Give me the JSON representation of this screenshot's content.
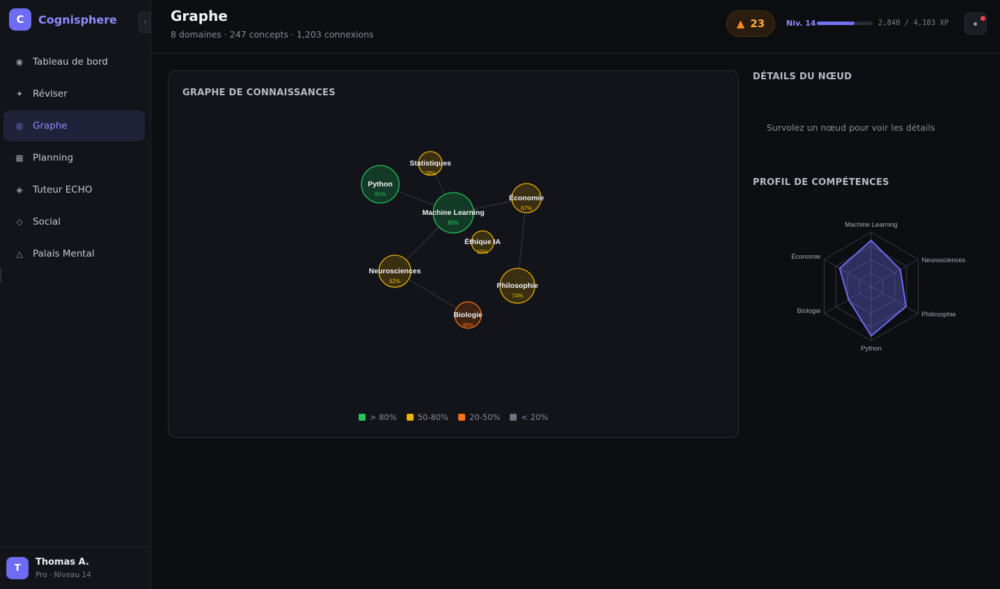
{
  "brand": {
    "logo_letter": "C",
    "name": "Cognisphere",
    "collapse_icon": "‹"
  },
  "nav": [
    {
      "key": "dashboard",
      "label": "Tableau de bord",
      "icon": "◉",
      "active": false
    },
    {
      "key": "review",
      "label": "Réviser",
      "icon": "✦",
      "active": false
    },
    {
      "key": "graph",
      "label": "Graphe",
      "icon": "◎",
      "active": true
    },
    {
      "key": "planning",
      "label": "Planning",
      "icon": "▦",
      "active": false
    },
    {
      "key": "tutor",
      "label": "Tuteur ECHO",
      "icon": "◈",
      "active": false
    },
    {
      "key": "social",
      "label": "Social",
      "icon": "◇",
      "active": false
    },
    {
      "key": "palace",
      "label": "Palais Mental",
      "icon": "△",
      "active": false
    }
  ],
  "user": {
    "initial": "T",
    "name": "Thomas A.",
    "subtitle": "Pro · Niveau 14"
  },
  "header": {
    "title": "Graphe",
    "subtitle": "8 domaines · 247 concepts · 1,203 connexions",
    "streak": "23",
    "level": "Niv. 14",
    "xp_text": "2,840 / 4,183 XP",
    "xp_fraction": 0.679
  },
  "colors": {
    "green": "#22c55e",
    "yellow": "#eab308",
    "orange": "#f97316",
    "gray": "#6b7280",
    "accent": "#6d6cf2"
  },
  "graph": {
    "title": "GRAPHE DE CONNAISSANCES",
    "nodes": [
      {
        "id": "ml",
        "label": "Machine Learning",
        "pct": "85%",
        "level": "green"
      },
      {
        "id": "python",
        "label": "Python",
        "pct": "91%",
        "level": "green"
      },
      {
        "id": "stats",
        "label": "Statistiques",
        "pct": "78%",
        "level": "yellow"
      },
      {
        "id": "eco",
        "label": "Économie",
        "pct": "67%",
        "level": "yellow"
      },
      {
        "id": "ethics",
        "label": "Éthique IA",
        "pct": "55%",
        "level": "yellow"
      },
      {
        "id": "neuro",
        "label": "Neurosciences",
        "pct": "62%",
        "level": "yellow"
      },
      {
        "id": "philo",
        "label": "Philosophie",
        "pct": "74%",
        "level": "yellow"
      },
      {
        "id": "bio",
        "label": "Biologie",
        "pct": "48%",
        "level": "orange"
      }
    ],
    "edges": [
      [
        "python",
        "ml"
      ],
      [
        "stats",
        "ml"
      ],
      [
        "ml",
        "eco"
      ],
      [
        "ml",
        "neuro"
      ],
      [
        "neuro",
        "bio"
      ],
      [
        "eco",
        "philo"
      ]
    ],
    "legend": [
      {
        "label": "> 80%",
        "color": "#22c55e"
      },
      {
        "label": "50-80%",
        "color": "#eab308"
      },
      {
        "label": "20-50%",
        "color": "#f97316"
      },
      {
        "label": "< 20%",
        "color": "#6b7280"
      }
    ]
  },
  "details": {
    "title": "DÉTAILS DU NŒUD",
    "hint": "Survolez un nœud pour voir les détails"
  },
  "radar": {
    "title": "PROFIL DE COMPÉTENCES",
    "axes": [
      "Machine Learning",
      "Neurosciences",
      "Philosophie",
      "Python",
      "Biologie",
      "Économie"
    ],
    "values": [
      0.85,
      0.62,
      0.74,
      0.91,
      0.48,
      0.67
    ]
  }
}
